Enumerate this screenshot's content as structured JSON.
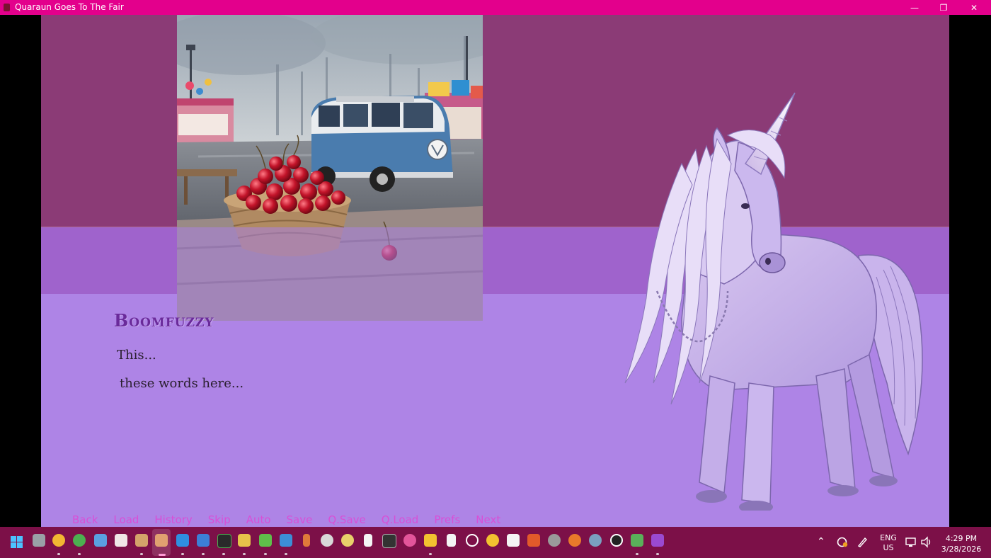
{
  "window": {
    "title": "Quaraun Goes To The Fair",
    "minimize_glyph": "—",
    "restore_glyph": "❐",
    "close_glyph": "✕"
  },
  "dialogue": {
    "speaker": "Boomfuzzy",
    "lines": [
      "This...",
      "these words here..."
    ]
  },
  "quick_menu": [
    "Back",
    "Load",
    "History",
    "Skip",
    "Auto",
    "Save",
    "Q.Save",
    "Q.Load",
    "Prefs",
    "Next"
  ],
  "colors": {
    "titlebar": "#e3008c",
    "band_top": "#8b3b76",
    "band_mid": "#9f63cc",
    "band_bottom": "#ae84e6",
    "speaker_name": "#6a2a9a",
    "quick_menu_text": "#d84fd6",
    "taskbar": "#7c1048"
  },
  "taskbar": {
    "tray": {
      "lang_line1": "ENG",
      "lang_line2": "US",
      "time": "4:29 PM",
      "date": "3/28/2026"
    }
  }
}
